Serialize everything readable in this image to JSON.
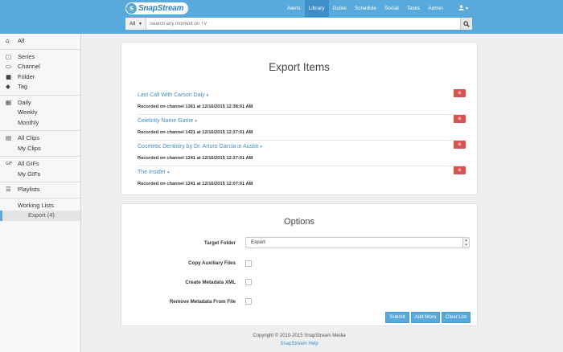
{
  "header": {
    "logo_text": "SnapStream",
    "logo_mark": "S",
    "nav": [
      "Alerts",
      "Library",
      "Guide",
      "Schedule",
      "Social",
      "Tasks",
      "Admin"
    ],
    "active_nav": "Library",
    "user_caret": "▾"
  },
  "search": {
    "scope": "All",
    "placeholder": "Search any moment on TV"
  },
  "sidebar": {
    "groups": [
      [
        {
          "label": "All",
          "icon": "home-icon"
        }
      ],
      [
        {
          "label": "Series",
          "icon": "series-icon"
        },
        {
          "label": "Channel",
          "icon": "monitor-icon"
        },
        {
          "label": "Folder",
          "icon": "folder-icon"
        },
        {
          "label": "Tag",
          "icon": "tag-icon"
        }
      ],
      [
        {
          "label": "Daily",
          "icon": "calendar-icon"
        },
        {
          "label": "Weekly"
        },
        {
          "label": "Monthly"
        }
      ],
      [
        {
          "label": "All Clips",
          "icon": "film-icon"
        },
        {
          "label": "My Clips"
        }
      ],
      [
        {
          "label": "All GIFs",
          "icon": "gif-icon"
        },
        {
          "label": "My GIFs"
        }
      ],
      [
        {
          "label": "Playlists",
          "icon": "list-icon"
        }
      ],
      [
        {
          "label": "Working Lists"
        },
        {
          "label": "Export (4)",
          "active": true
        }
      ]
    ]
  },
  "export": {
    "title": "Export Items",
    "items": [
      {
        "title": "Last Call With Carson Daly",
        "meta": "Recorded on channel 1361 at 12/16/2015 12:38:01 AM"
      },
      {
        "title": "Celebrity Name Game",
        "meta": "Recorded on channel 1421 at 12/16/2015 12:37:01 AM"
      },
      {
        "title": "Cosmetic Dentistry by Dr. Arturo Garcia in Austin",
        "meta": "Recorded on channel 1241 at 12/16/2015 12:37:01 AM"
      },
      {
        "title": "The Insider",
        "meta": "Recorded on channel 1241 at 12/16/2015 12:07:01 AM"
      }
    ]
  },
  "options": {
    "title": "Options",
    "target_folder_label": "Target Folder",
    "target_folder_value": "Export",
    "copy_aux_label": "Copy Auxiliary Files",
    "create_xml_label": "Create Metadata XML",
    "remove_meta_label": "Remove Metadata From File",
    "submit_label": "Submit",
    "add_more_label": "Add More",
    "clear_list_label": "Clear List"
  },
  "footer": {
    "copyright": "Copyright © 2010-2015 SnapStream Media",
    "help": "SnapStream Help"
  }
}
